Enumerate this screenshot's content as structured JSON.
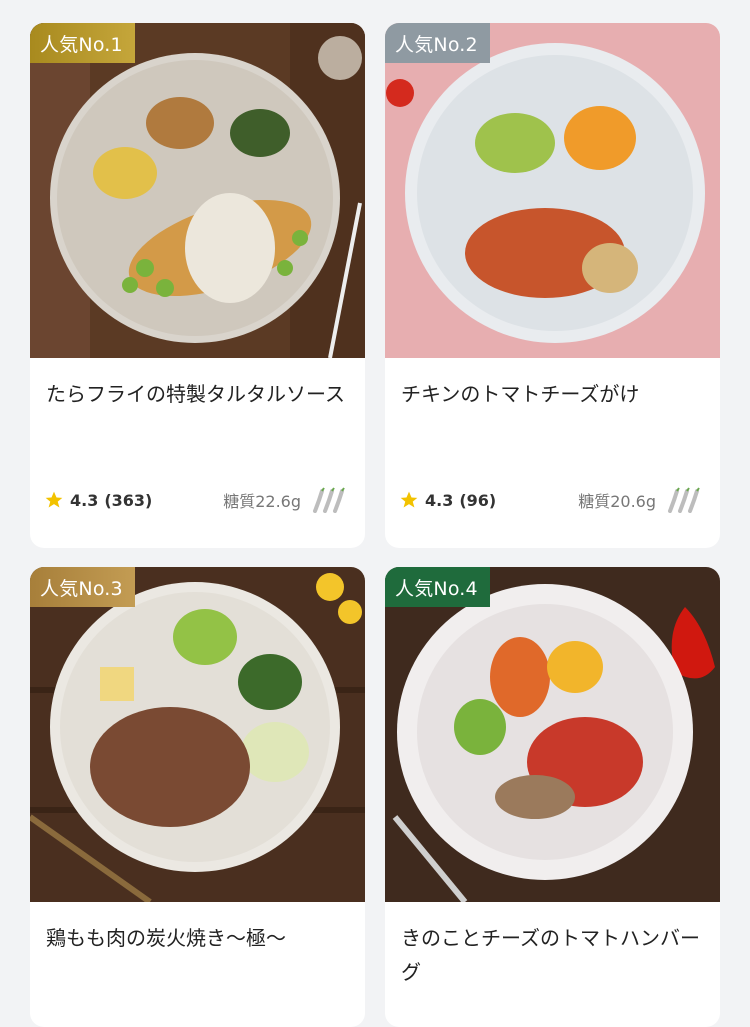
{
  "products": [
    {
      "rank": "人気No.1",
      "title": "たらフライの特製タルタルソース",
      "rating": "4.3",
      "reviews": "(363)",
      "carbs": "糖質22.6g",
      "spice_icon": "chili-pepper-icon"
    },
    {
      "rank": "人気No.2",
      "title": "チキンのトマトチーズがけ",
      "rating": "4.3",
      "reviews": "(96)",
      "carbs": "糖質20.6g",
      "spice_icon": "chili-pepper-icon"
    },
    {
      "rank": "人気No.3",
      "title": "鶏もも肉の炭火焼き〜極〜",
      "rating": "",
      "reviews": "",
      "carbs": "",
      "spice_icon": ""
    },
    {
      "rank": "人気No.4",
      "title": "きのことチーズのトマトハンバーグ",
      "rating": "",
      "reviews": "",
      "carbs": "",
      "spice_icon": ""
    }
  ],
  "icons": {
    "star": "star-icon",
    "chili": "chili-pepper-icon"
  },
  "colors": {
    "star": "#f2c200",
    "rank_gold": "#b8972d",
    "rank_silver": "#8f9aa2",
    "rank_bronze": "#b08a45",
    "rank_green": "#1f6b3c"
  }
}
